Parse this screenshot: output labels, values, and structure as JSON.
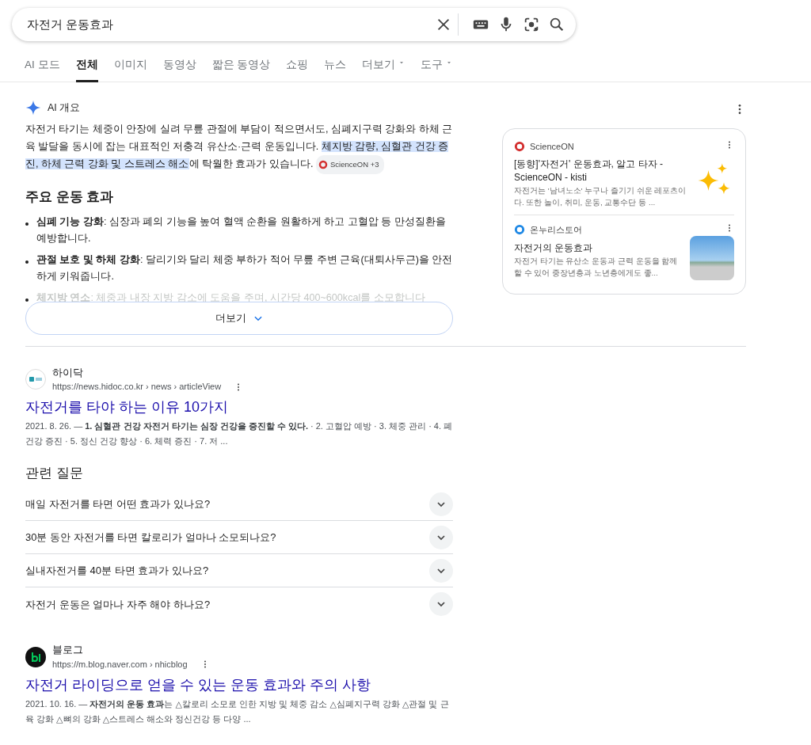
{
  "search": {
    "value": "자전거 운동효과"
  },
  "tabs": [
    {
      "label": "AI 모드",
      "selected": false,
      "dropdown": false
    },
    {
      "label": "전체",
      "selected": true,
      "dropdown": false
    },
    {
      "label": "이미지",
      "selected": false,
      "dropdown": false
    },
    {
      "label": "동영상",
      "selected": false,
      "dropdown": false
    },
    {
      "label": "짧은 동영상",
      "selected": false,
      "dropdown": false
    },
    {
      "label": "쇼핑",
      "selected": false,
      "dropdown": false
    },
    {
      "label": "뉴스",
      "selected": false,
      "dropdown": false
    },
    {
      "label": "더보기",
      "selected": false,
      "dropdown": true
    },
    {
      "label": "도구",
      "selected": false,
      "dropdown": true
    }
  ],
  "ai_overview": {
    "title": "AI 개요",
    "summary": {
      "before": "자전거 타기는 체중이 안장에 실려 무릎 관절에 부담이 적으면서도, 심폐지구력 강화와 하체 근육 발달을 동시에 잡는 대표적인 저충격 유산소·근력 운동입니다. ",
      "highlight": "체지방 감량, 심혈관 건강 증진, 하체 근력 강화 및 스트레스 해소",
      "after": "에 탁월한 효과가 있습니다. "
    },
    "citation": "ScienceON +3",
    "heading": "주요 운동 효과",
    "bullets": [
      {
        "text": "**심폐 기능 강화**: 심장과 폐의 기능을 높여 혈액 순환을 원활하게 하고 고혈압 등 만성질환을 예방합니다.",
        "faded": false
      },
      {
        "text": "**관절 보호 및 하체 강화**: 달리기와 달리 체중 부하가 적어 무릎 주변 근육(대퇴사두근)을 안전하게 키워줍니다.",
        "faded": false
      },
      {
        "text": "**체지방 연소**: 체중과 내장 지방 감소에 도움을 주며, 시간당 400~600kcal를 소모합니다",
        "faded": true
      }
    ],
    "more_button": "더보기",
    "sources": [
      {
        "site": "ScienceON",
        "title": "[동향]'자전거' 운동효과, 알고 타자 - ScienceON - kisti",
        "snippet": "자전거는 '남녀노소' 누구나 즐기기 쉬운 레포츠이다. 또한 놀이, 취미, 운동, 교통수단 등 ..."
      },
      {
        "site": "온누리스토어",
        "title": "자전거의 운동효과",
        "snippet": "자전거 타기는 유산소 운동과 근력 운동을 함께 할 수 있어 중장년층과 노년층에게도 좋..."
      }
    ]
  },
  "results": [
    {
      "site": "하이닥",
      "url": "https://news.hidoc.co.kr › news › articleView",
      "title": "자전거를 타야 하는 이유 10가지",
      "snippet": "2021. 8. 26. — **1. 심혈관 건강 자전거 타기는 심장 건강을 증진할 수 있다.** · 2. 고혈압 예방 · 3. 체중 관리 · 4. 폐 건강 증진 · 5. 정신 건강 향상 · 6. 체력 증진 · 7. 저 ..."
    }
  ],
  "related": {
    "title": "관련 질문",
    "questions": [
      "매일 자전거를 타면 어떤 효과가 있나요?",
      "30분 동안 자전거를 타면 칼로리가 얼마나 소모되나요?",
      "실내자전거를 40분 타면 효과가 있나요?",
      "자전거 운동은 얼마나 자주 해야 하나요?"
    ]
  },
  "results_after": [
    {
      "site": "블로그",
      "url": "https://m.blog.naver.com › nhicblog",
      "title": "자전거 라이딩으로 얻을 수 있는 운동 효과와 주의 사항",
      "snippet": "2021. 10. 16. — **자전거의 운동 효과**는 △칼로리 소모로 인한 지방 및 체중 감소 △심폐지구력 강화 △관절 및 근육 강화 △뼈의 강화 △스트레스 해소와 정신건강 등 다양 ..."
    }
  ]
}
